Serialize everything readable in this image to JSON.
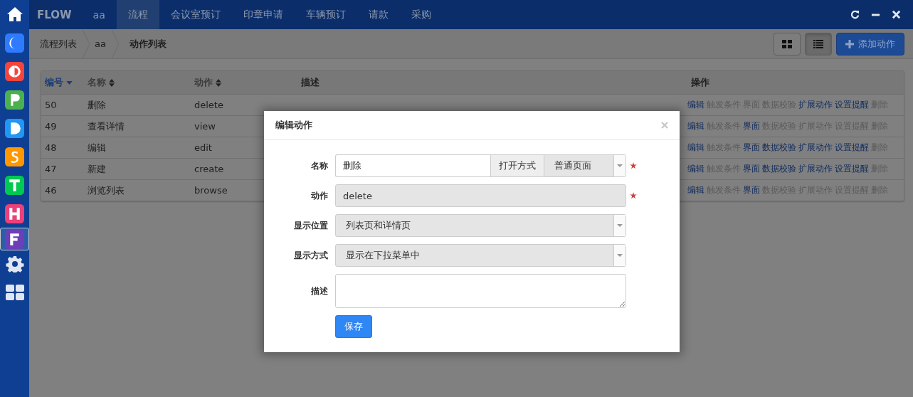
{
  "sidebar": {
    "apps": [
      {
        "kind": "crescent",
        "color": "#2f7bff",
        "selected": false
      },
      {
        "kind": "split-circle",
        "color": "#f2453d",
        "selected": false
      },
      {
        "kind": "flag",
        "color": "#4caf50",
        "selected": false
      },
      {
        "kind": "dome",
        "color": "#2196f3",
        "selected": false
      },
      {
        "kind": "zigzag",
        "color": "#ff9800",
        "selected": false
      },
      {
        "kind": "tee",
        "color": "#00c853",
        "selected": false
      },
      {
        "kind": "ladder",
        "color": "#ec407a",
        "selected": false
      },
      {
        "kind": "fork",
        "color": "#6a3fb8",
        "selected": true
      }
    ]
  },
  "top_bar": {
    "brand": "FLOW",
    "nav": [
      {
        "label": "aa",
        "selected": false
      },
      {
        "label": "流程",
        "selected": true
      },
      {
        "label": "会议室预订",
        "selected": false
      },
      {
        "label": "印章申请",
        "selected": false
      },
      {
        "label": "车辆预订",
        "selected": false
      },
      {
        "label": "请款",
        "selected": false
      },
      {
        "label": "采购",
        "selected": false
      }
    ]
  },
  "breadcrumb": [
    {
      "label": "流程列表",
      "current": false
    },
    {
      "label": "aa",
      "current": false
    },
    {
      "label": "动作列表",
      "current": true
    }
  ],
  "toolbar": {
    "views": [
      {
        "kind": "grid",
        "selected": false
      },
      {
        "kind": "list",
        "selected": true
      }
    ],
    "add_button": "添加动作"
  },
  "table": {
    "columns": [
      {
        "label": "编号",
        "sortable": true,
        "sorted": true
      },
      {
        "label": "名称",
        "sortable": true,
        "sorted": false
      },
      {
        "label": "动作",
        "sortable": true,
        "sorted": false
      },
      {
        "label": "描述",
        "sortable": false,
        "sorted": false
      },
      {
        "label": "操作",
        "sortable": false,
        "sorted": false
      }
    ],
    "rows": [
      {
        "id": "50",
        "name": "删除",
        "action": "delete",
        "ops": [
          {
            "label": "编辑",
            "enabled": true
          },
          {
            "label": "触发条件",
            "enabled": false
          },
          {
            "label": "界面",
            "enabled": false
          },
          {
            "label": "数据校验",
            "enabled": false
          },
          {
            "label": "扩展动作",
            "enabled": true
          },
          {
            "label": "设置提醒",
            "enabled": true
          },
          {
            "label": "删除",
            "enabled": false
          }
        ]
      },
      {
        "id": "49",
        "name": "查看详情",
        "action": "view",
        "ops": [
          {
            "label": "编辑",
            "enabled": true
          },
          {
            "label": "触发条件",
            "enabled": false
          },
          {
            "label": "界面",
            "enabled": true
          },
          {
            "label": "数据校验",
            "enabled": false
          },
          {
            "label": "扩展动作",
            "enabled": false
          },
          {
            "label": "设置提醒",
            "enabled": false
          },
          {
            "label": "删除",
            "enabled": false
          }
        ]
      },
      {
        "id": "48",
        "name": "编辑",
        "action": "edit",
        "ops": [
          {
            "label": "编辑",
            "enabled": true
          },
          {
            "label": "触发条件",
            "enabled": false
          },
          {
            "label": "界面",
            "enabled": true
          },
          {
            "label": "数据校验",
            "enabled": true
          },
          {
            "label": "扩展动作",
            "enabled": true
          },
          {
            "label": "设置提醒",
            "enabled": true
          },
          {
            "label": "删除",
            "enabled": false
          }
        ]
      },
      {
        "id": "47",
        "name": "新建",
        "action": "create",
        "ops": [
          {
            "label": "编辑",
            "enabled": true
          },
          {
            "label": "触发条件",
            "enabled": false
          },
          {
            "label": "界面",
            "enabled": true
          },
          {
            "label": "数据校验",
            "enabled": true
          },
          {
            "label": "扩展动作",
            "enabled": true
          },
          {
            "label": "设置提醒",
            "enabled": true
          },
          {
            "label": "删除",
            "enabled": false
          }
        ]
      },
      {
        "id": "46",
        "name": "浏览列表",
        "action": "browse",
        "ops": [
          {
            "label": "编辑",
            "enabled": true
          },
          {
            "label": "触发条件",
            "enabled": false
          },
          {
            "label": "界面",
            "enabled": true
          },
          {
            "label": "数据校验",
            "enabled": false
          },
          {
            "label": "扩展动作",
            "enabled": false
          },
          {
            "label": "设置提醒",
            "enabled": false
          },
          {
            "label": "删除",
            "enabled": false
          }
        ]
      }
    ]
  },
  "modal": {
    "title": "编辑动作",
    "fields": [
      {
        "kind": "text-with-select",
        "label": "名称",
        "value": "删除",
        "addon": "打开方式",
        "option": "普通页面",
        "required": true
      },
      {
        "kind": "readonly",
        "label": "动作",
        "value": "delete",
        "required": true
      },
      {
        "kind": "select",
        "label": "显示位置",
        "value": "列表页和详情页",
        "required": false
      },
      {
        "kind": "select",
        "label": "显示方式",
        "value": "显示在下拉菜单中",
        "required": false
      },
      {
        "kind": "textarea",
        "label": "描述",
        "required": false
      }
    ],
    "save_button": "保存"
  }
}
